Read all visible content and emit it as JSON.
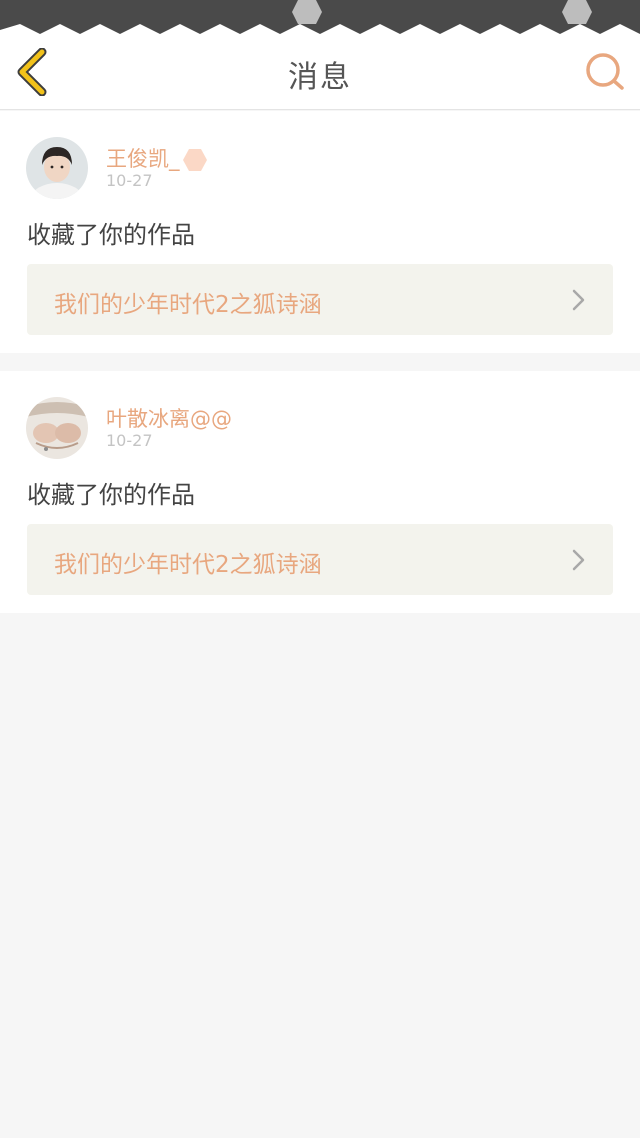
{
  "nav": {
    "title": "消息"
  },
  "messages": [
    {
      "username": "王俊凯_",
      "date": "10-27",
      "action": "收藏了你的作品",
      "work_title": "我们的少年时代2之狐诗涵"
    },
    {
      "username": "叶散冰离@@",
      "date": "10-27",
      "action": "收藏了你的作品",
      "work_title": "我们的少年时代2之狐诗涵"
    }
  ],
  "colors": {
    "accent": "#e8a77f",
    "back_arrow": "#f2c21a",
    "background": "#f6f6f6",
    "status_bar": "#4a4a4a"
  },
  "icons": {
    "back": "chevron-left-icon",
    "search": "search-icon",
    "link": "chevron-right-icon"
  }
}
